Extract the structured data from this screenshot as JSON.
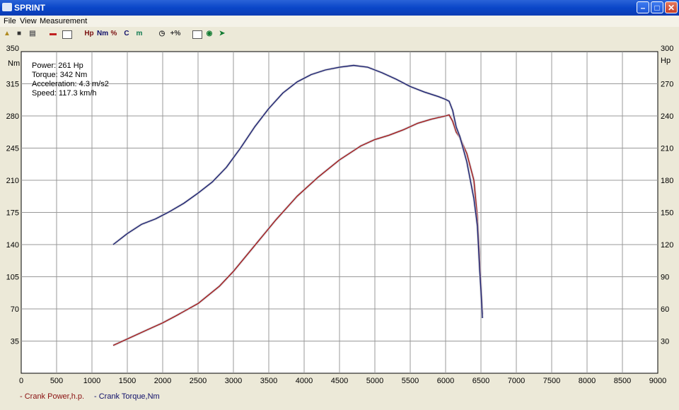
{
  "window": {
    "title": "SPRINT"
  },
  "menu": [
    "File",
    "View",
    "Measurement"
  ],
  "toolbar": {
    "hp": "Hp",
    "nm": "Nm",
    "pct": "%",
    "c": "C",
    "m": "m",
    "plus_pct": "+%"
  },
  "colors": {
    "power": "#a01818",
    "torque": "#1a1f6e",
    "grid": "#999999"
  },
  "chart_data": {
    "type": "line",
    "xlim": [
      0,
      9000
    ],
    "xticks": [
      0,
      500,
      1000,
      1500,
      2000,
      2500,
      3000,
      3500,
      4000,
      4500,
      5000,
      5500,
      6000,
      6500,
      7000,
      7500,
      8000,
      8500,
      9000
    ],
    "left_axis": {
      "unit": "Nm",
      "ylim": [
        0,
        350
      ],
      "ticks": [
        35,
        70,
        105,
        140,
        175,
        210,
        245,
        280,
        315,
        350
      ]
    },
    "right_axis": {
      "unit": "Hp",
      "ylim": [
        0,
        300
      ],
      "ticks": [
        30,
        60,
        90,
        120,
        150,
        180,
        210,
        240,
        270,
        300
      ]
    },
    "annotations": [
      "Power: 261 Hp",
      "Torque: 342 Nm",
      "Acceleration: 4.3 m/s2",
      "Speed: 117.3 km/h"
    ],
    "legend": [
      "- Crank Power,h.p.",
      "- Crank Torque,Nm"
    ],
    "series": [
      {
        "name": "Crank Power,h.p.",
        "axis": "right",
        "x": [
          1300,
          1500,
          1800,
          2000,
          2200,
          2500,
          2800,
          3000,
          3300,
          3600,
          3900,
          4200,
          4500,
          4800,
          5000,
          5200,
          5400,
          5600,
          5800,
          6000,
          6050,
          6100,
          6150,
          6200,
          6300,
          6400,
          6450,
          6480,
          6500,
          6520
        ],
        "y": [
          26,
          32,
          41,
          47,
          54,
          65,
          81,
          95,
          119,
          143,
          165,
          183,
          199,
          212,
          218,
          222,
          227,
          233,
          237,
          240,
          241,
          235,
          225,
          220,
          205,
          180,
          145,
          110,
          80,
          55
        ]
      },
      {
        "name": "Crank Torque,Nm",
        "axis": "left",
        "x": [
          1300,
          1500,
          1700,
          1900,
          2100,
          2300,
          2500,
          2700,
          2900,
          3100,
          3300,
          3500,
          3700,
          3900,
          4100,
          4300,
          4500,
          4700,
          4900,
          5100,
          5300,
          5500,
          5700,
          5900,
          6000,
          6050,
          6100,
          6150,
          6200,
          6300,
          6400,
          6450,
          6480,
          6500,
          6520
        ],
        "y": [
          140,
          152,
          162,
          168,
          176,
          185,
          196,
          208,
          224,
          245,
          268,
          288,
          305,
          317,
          325,
          330,
          333,
          335,
          333,
          327,
          320,
          312,
          306,
          301,
          298,
          296,
          286,
          268,
          258,
          230,
          190,
          160,
          115,
          90,
          60
        ]
      }
    ]
  }
}
